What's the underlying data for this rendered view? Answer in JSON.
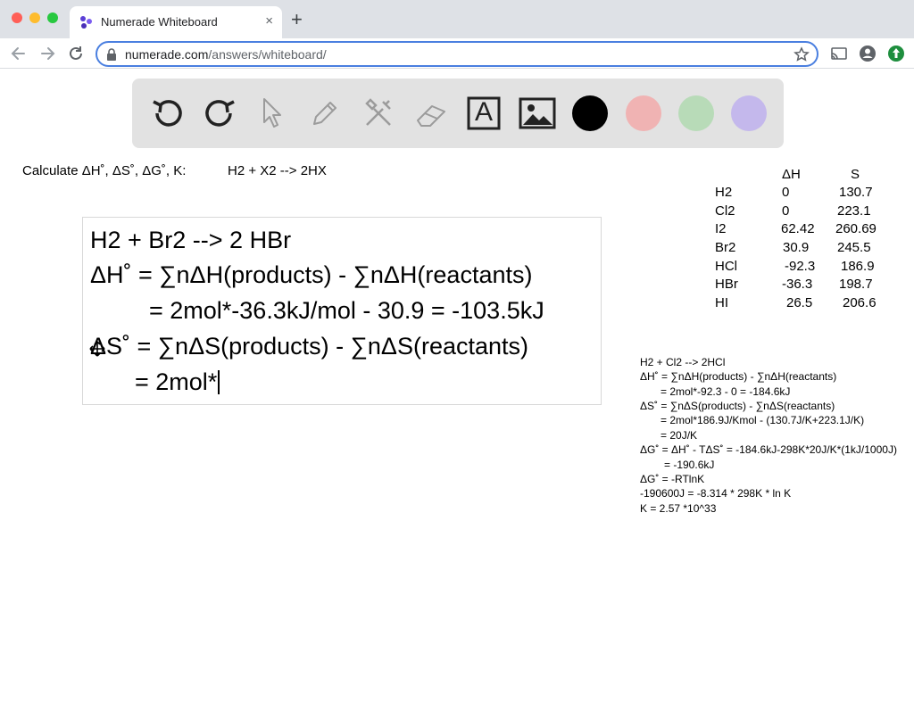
{
  "browser": {
    "tab_title": "Numerade Whiteboard",
    "tab_close": "×",
    "new_tab": "+",
    "url_host": "numerade.com",
    "url_path": "/answers/whiteboard/"
  },
  "toolbar": {
    "tools": [
      "undo-icon",
      "redo-icon",
      "pointer-icon",
      "pen-icon",
      "tools-icon",
      "eraser-icon",
      "text-icon",
      "image-icon"
    ],
    "text_tool_glyph": "A",
    "colors": [
      "#000000",
      "#f0b3b3",
      "#b8dbb8",
      "#c4b8ec"
    ]
  },
  "prompt": {
    "calc": "Calculate ΔH˚, ΔS˚, ΔG˚, K:",
    "reaction": "H2 + X2 --> 2HX"
  },
  "editor": {
    "lines": [
      "H2 + Br2 --> 2 HBr",
      "ΔH˚ = ∑nΔH(products) - ∑nΔH(reactants)",
      "= 2mol*-36.3kJ/mol - 30.9 = -103.5kJ",
      "ΔS˚ = ∑nΔS(products) - ∑nΔS(reactants)",
      "= 2mol*"
    ]
  },
  "thermo_table": {
    "headers": [
      "ΔH",
      "S"
    ],
    "rows": [
      {
        "species": "H2",
        "dH": "0",
        "S": "130.7"
      },
      {
        "species": "Cl2",
        "dH": "0",
        "S": "223.1"
      },
      {
        "species": "I2",
        "dH": "62.42",
        "S": "260.69"
      },
      {
        "species": "Br2",
        "dH": "30.9",
        "S": "245.5"
      },
      {
        "species": "HCl",
        "dH": "-92.3",
        "S": "186.9"
      },
      {
        "species": "HBr",
        "dH": "-36.3",
        "S": "198.7"
      },
      {
        "species": "HI",
        "dH": "26.5",
        "S": "206.6"
      }
    ]
  },
  "worked_example": [
    "H2 + Cl2 --> 2HCl",
    "ΔH˚ = ∑nΔH(products) - ∑nΔH(reactants)",
    "= 2mol*-92.3 - 0 = -184.6kJ",
    "ΔS˚ = ∑nΔS(products) - ∑nΔS(reactants)",
    "= 2mol*186.9J/Kmol - (130.7J/K+223.1J/K)",
    "= 20J/K",
    "ΔG˚ = ΔH˚ - TΔS˚ = -184.6kJ-298K*20J/K*(1kJ/1000J)",
    "= -190.6kJ",
    "ΔG˚ = -RTlnK",
    "-190600J = -8.314 * 298K * ln K",
    "K = 2.57 *10^33"
  ]
}
